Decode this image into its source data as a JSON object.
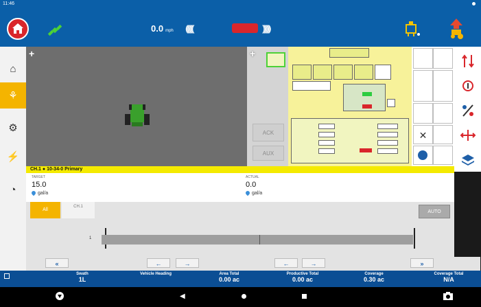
{
  "status_bar": {
    "time": "11:46"
  },
  "header": {
    "speed_value": "0.0",
    "speed_unit": "mph",
    "chevrons_left": "((((((((",
    "chevrons_right": "))))))))"
  },
  "left_nav": {
    "items": [
      {
        "icon": "home-icon",
        "glyph": "⌂"
      },
      {
        "icon": "field-run-icon",
        "glyph": "⚘"
      },
      {
        "icon": "guidance-settings-icon",
        "glyph": "⚙"
      },
      {
        "icon": "diagnostics-icon",
        "glyph": "⚡"
      },
      {
        "icon": "speedometer-icon",
        "glyph": "◔"
      }
    ]
  },
  "vt": {
    "ack_label": "ACK",
    "aux_label": "AUX"
  },
  "product": {
    "title": "CH.1 ● 10-34-0 Primary",
    "target_label": "TARGET",
    "target_value": "15.0",
    "target_unit": "gal/a",
    "actual_label": "ACTUAL",
    "actual_value": "0.0",
    "actual_unit": "gal/a"
  },
  "sections": {
    "tab_all": "All",
    "tab_ch1": "CH.1",
    "auto_label": "AUTO",
    "left_scale_label": "1"
  },
  "arrows": {
    "rewind": "«",
    "left": "←",
    "right": "→",
    "forward": "»"
  },
  "footer": {
    "swath_label": "Swath",
    "swath_value": "1L",
    "heading_label": "Vehicle Heading",
    "area_label": "Area Total",
    "area_value": "0.00 ac",
    "productive_label": "Productive Total",
    "productive_value": "0.00 ac",
    "coverage_label": "Coverage",
    "coverage_value": "0.30 ac",
    "coverage_total_label": "Coverage Total",
    "coverage_total_value": "N/A"
  },
  "colors": {
    "header_blue": "#0b5fa8",
    "accent_yellow": "#f4b400",
    "alert_red": "#d9262b",
    "product_bar_yellow": "#f4ea00",
    "footer_blue": "#0b4e94"
  }
}
